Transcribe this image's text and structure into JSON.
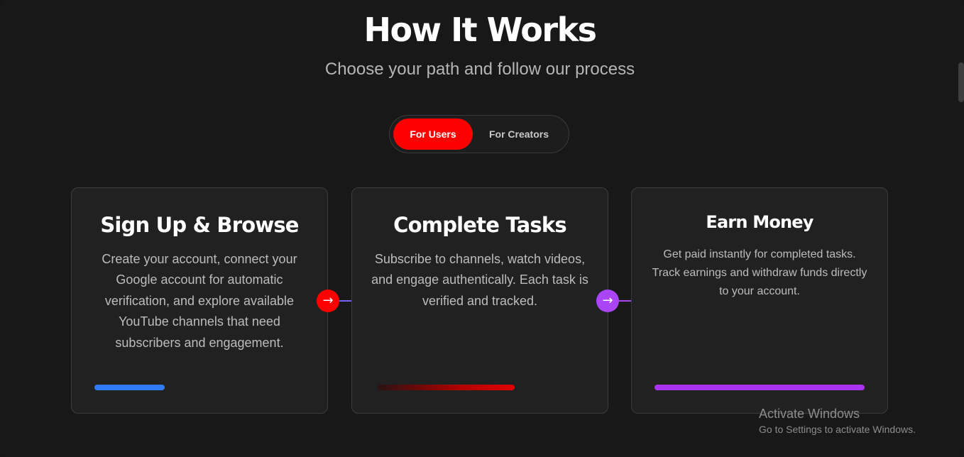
{
  "section": {
    "title": "How It Works",
    "subtitle": "Choose your path and follow our process"
  },
  "toggle": {
    "options": [
      "For Users",
      "For Creators"
    ],
    "selected": "For Users"
  },
  "steps": [
    {
      "title": "Sign Up & Browse",
      "description": "Create your account, connect your Google account for automatic verification, and explore available YouTube channels that need subscribers and engagement.",
      "accent": "#2f7cf6"
    },
    {
      "title": "Complete Tasks",
      "description": "Subscribe to channels, watch videos, and engage authentically. Each task is verified and tracked.",
      "accent": "#e00000"
    },
    {
      "title": "Earn Money",
      "description": "Get paid instantly for completed tasks. Track earnings and withdraw funds directly to your account.",
      "accent": "#a933ee"
    }
  ],
  "connectors": [
    {
      "icon": "arrow-right-icon",
      "glyph": "→",
      "color": "#ff0000"
    },
    {
      "icon": "arrow-right-icon",
      "glyph": "→",
      "color": "#a945f5"
    }
  ],
  "watermark": {
    "title": "Activate Windows",
    "subtitle": "Go to Settings to activate Windows."
  }
}
